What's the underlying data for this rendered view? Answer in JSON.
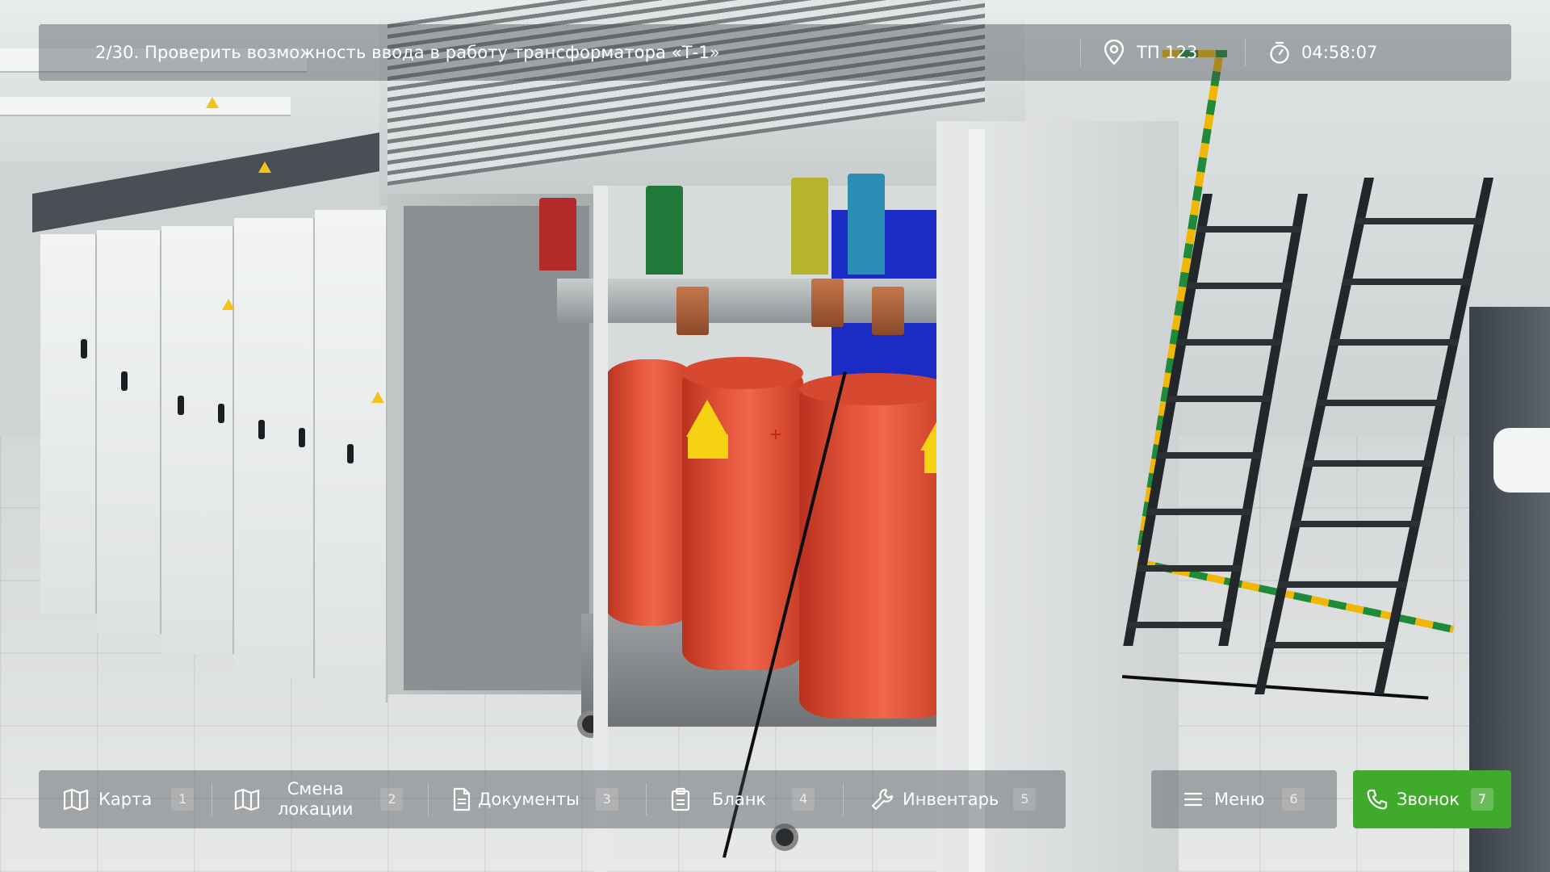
{
  "task": {
    "title": "2/30. Проверить возможность ввода в работу трансформатора «Т-1»"
  },
  "status": {
    "location": "ТП 123",
    "location_icon": "location-pin-icon",
    "timer": "04:58:07",
    "timer_icon": "stopwatch-icon"
  },
  "toolbar": {
    "items": [
      {
        "label": "Карта",
        "key": "1",
        "icon": "map-icon"
      },
      {
        "label_line1": "Смена",
        "label_line2": "локации",
        "key": "2",
        "icon": "map-icon"
      },
      {
        "label": "Документы",
        "key": "3",
        "icon": "document-icon"
      },
      {
        "label": "Бланк",
        "key": "4",
        "icon": "clipboard-icon"
      },
      {
        "label": "Инвентарь",
        "key": "5",
        "icon": "wrench-icon"
      }
    ],
    "menu": {
      "label": "Меню",
      "key": "6",
      "icon": "hamburger-icon"
    },
    "call": {
      "label": "Звонок",
      "key": "7",
      "icon": "phone-icon"
    }
  },
  "colors": {
    "call_button": "#3faa2b",
    "hud_background": "rgba(70,74,78,0.42)",
    "transformer_coil": "#e4553b"
  }
}
